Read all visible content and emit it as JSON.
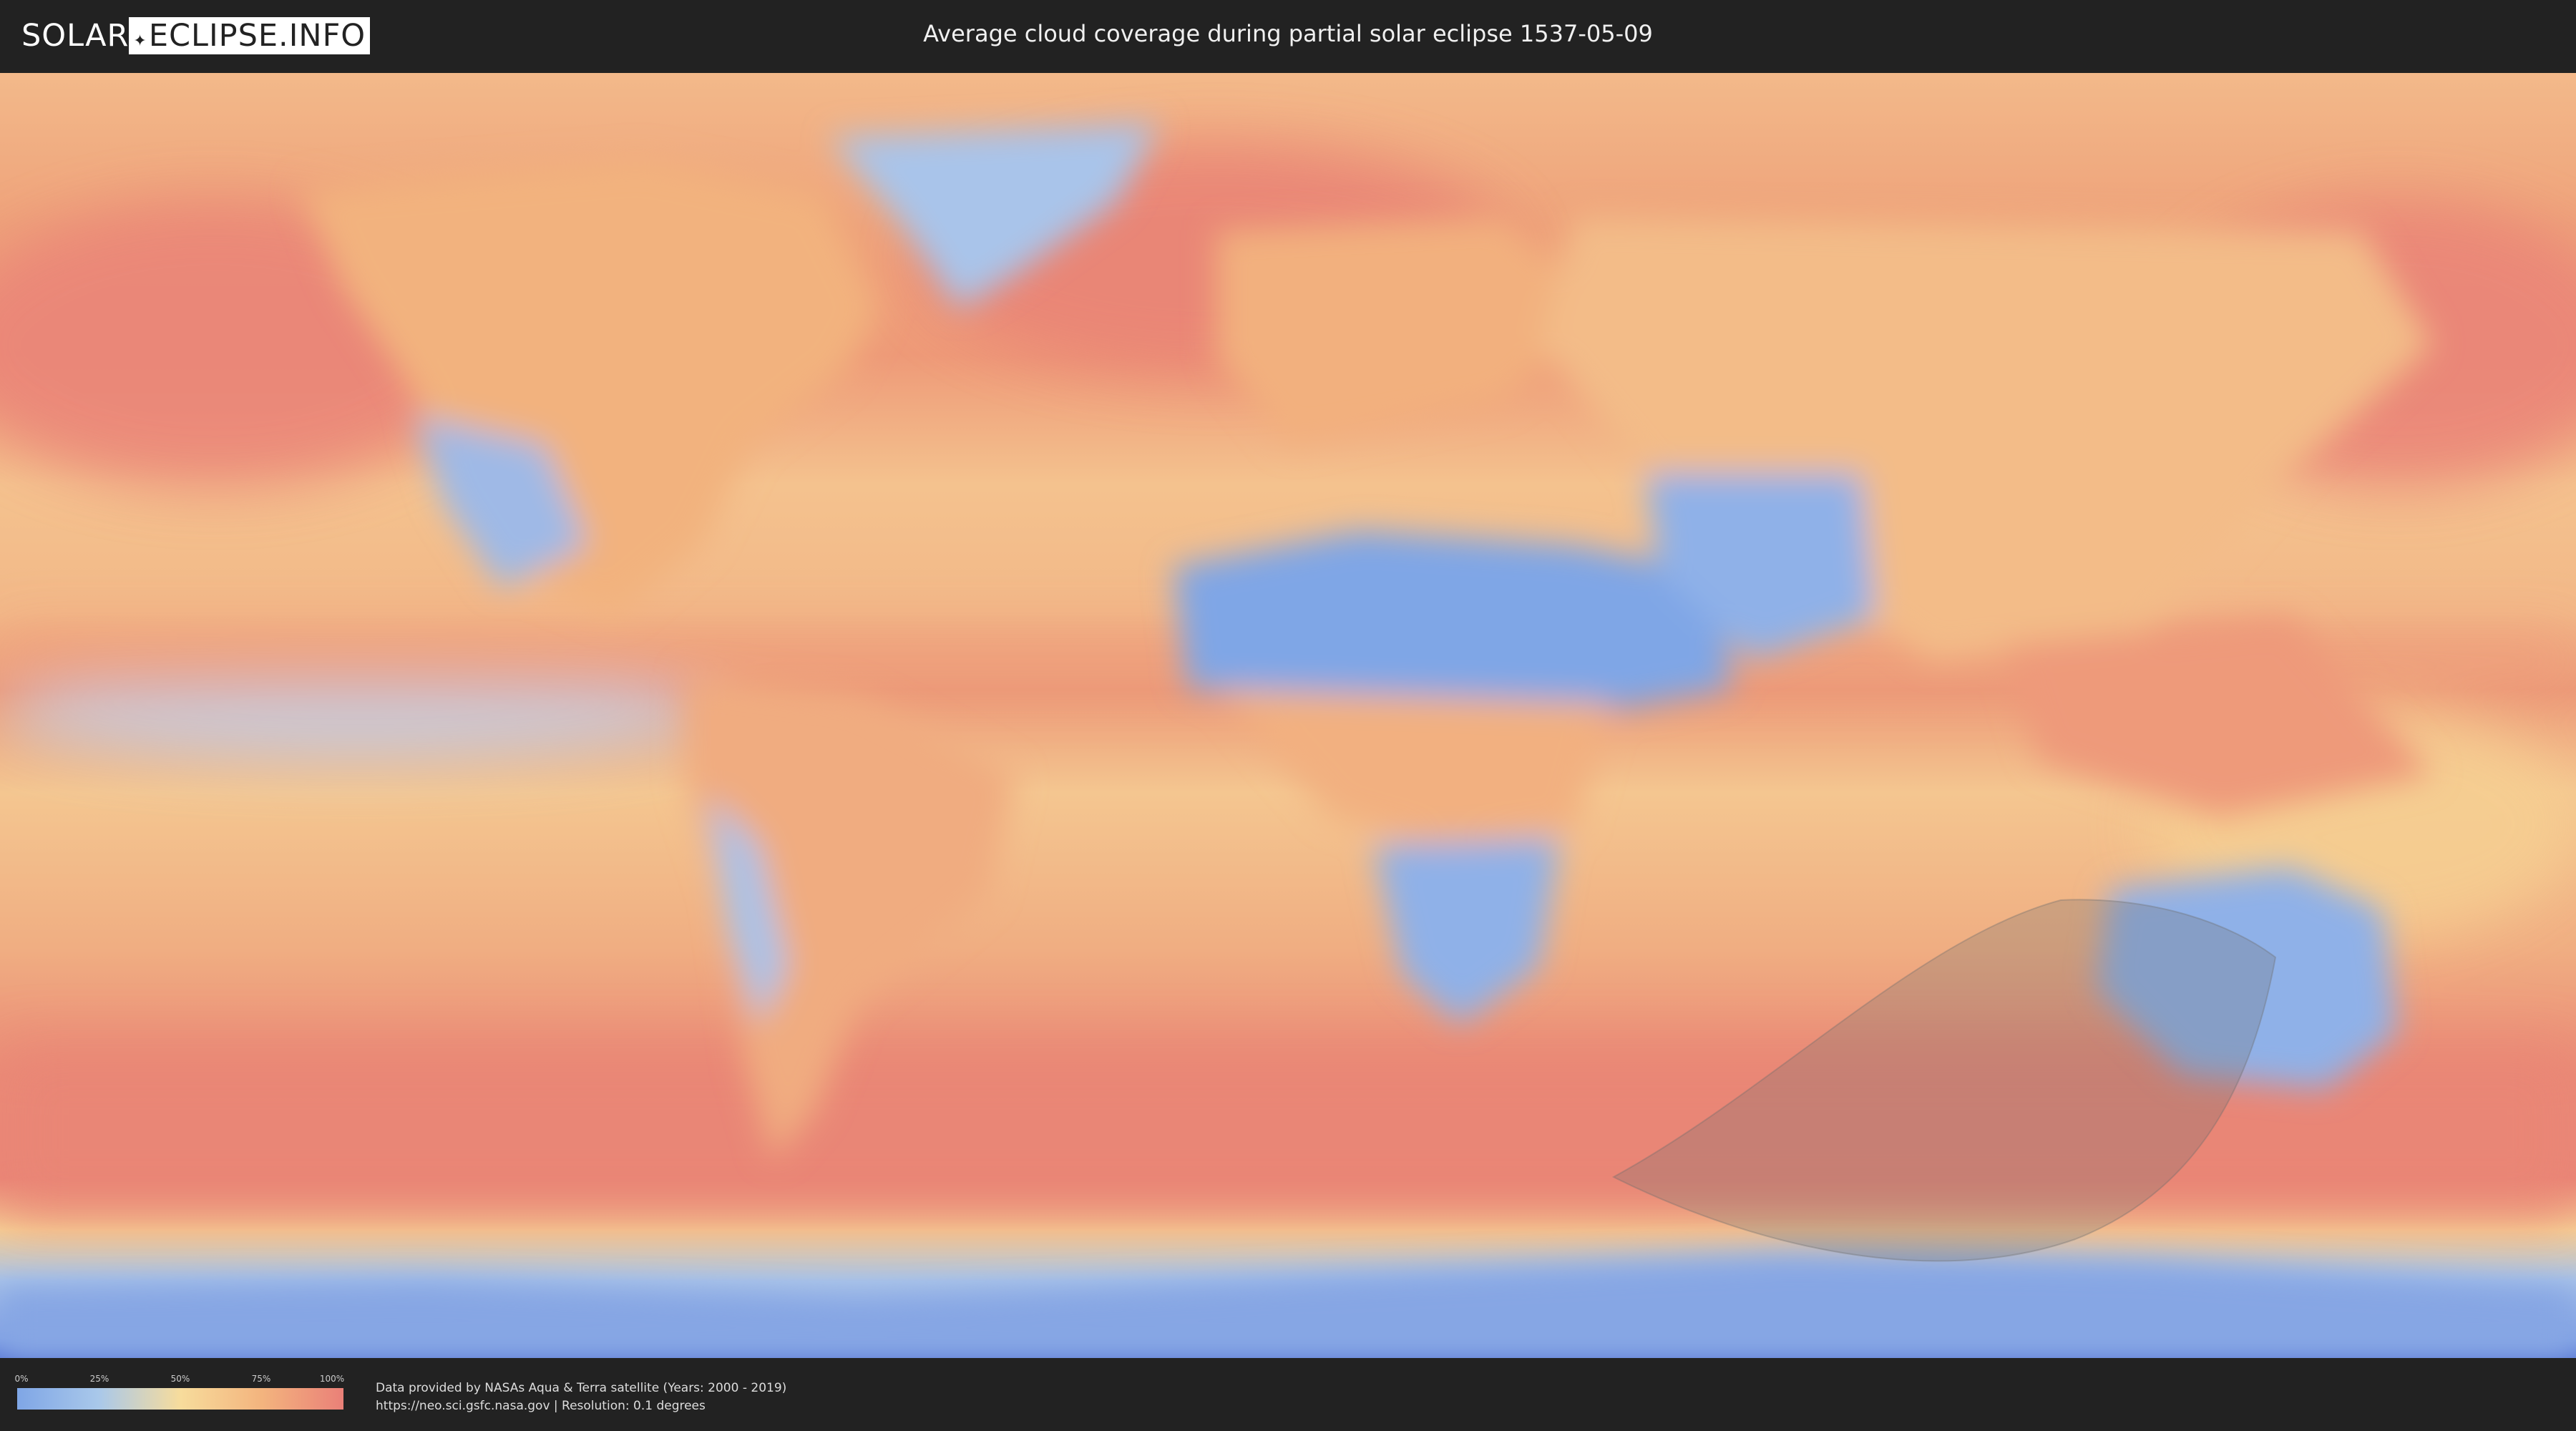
{
  "header": {
    "logo_prefix": "SOLAR",
    "logo_boxed": "ECLIPSE.INFO",
    "title": "Average cloud coverage during partial solar eclipse 1537-05-09"
  },
  "legend": {
    "ticks": [
      "0%",
      "25%",
      "50%",
      "75%",
      "100%"
    ],
    "colors": [
      "#7fa6e6",
      "#a9c8ea",
      "#f7dc9c",
      "#f3b47e",
      "#ea8078"
    ]
  },
  "credits": {
    "line1": "Data provided by NASAs Aqua & Terra satellite (Years: 2000 - 2019)",
    "line2": "https://neo.sci.gsfc.nasa.gov | Resolution: 0.1 degrees"
  },
  "map": {
    "projection": "equirectangular",
    "eclipse_visibility_region": "southern Indian Ocean to southern Australia",
    "colors": {
      "clear_sky": "#7fa6e6",
      "cloudy": "#ea8078",
      "eclipse_overlay": "#6e6e6e"
    }
  }
}
